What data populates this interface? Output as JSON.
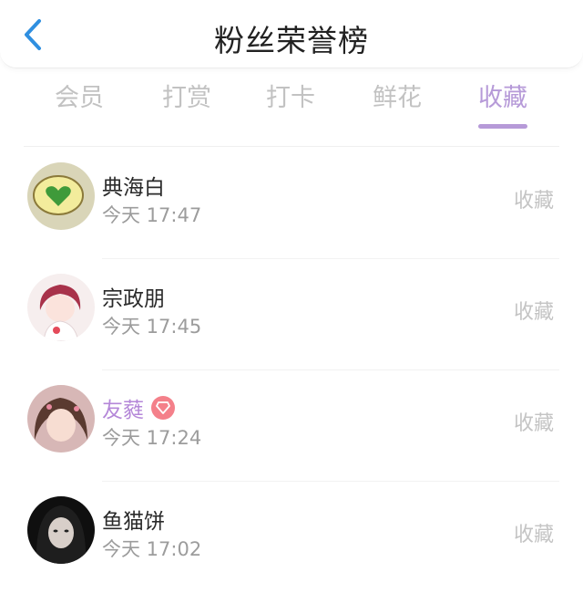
{
  "header": {
    "title": "粉丝荣誉榜",
    "back_icon": "chevron-left-icon"
  },
  "tabs": [
    {
      "label": "会员",
      "active": false
    },
    {
      "label": "打赏",
      "active": false
    },
    {
      "label": "打卡",
      "active": false
    },
    {
      "label": "鲜花",
      "active": false
    },
    {
      "label": "收藏",
      "active": true
    }
  ],
  "colors": {
    "accent": "#b69ad8",
    "vip_badge": "#f4808a",
    "back": "#2f8fe0"
  },
  "list": [
    {
      "name": "典海白",
      "time": "今天 17:47",
      "action": "收藏",
      "vip": false
    },
    {
      "name": "宗政朋",
      "time": "今天 17:45",
      "action": "收藏",
      "vip": false
    },
    {
      "name": "友蕤",
      "time": "今天 17:24",
      "action": "收藏",
      "vip": true
    },
    {
      "name": "鱼猫饼",
      "time": "今天 17:02",
      "action": "收藏",
      "vip": false
    }
  ]
}
